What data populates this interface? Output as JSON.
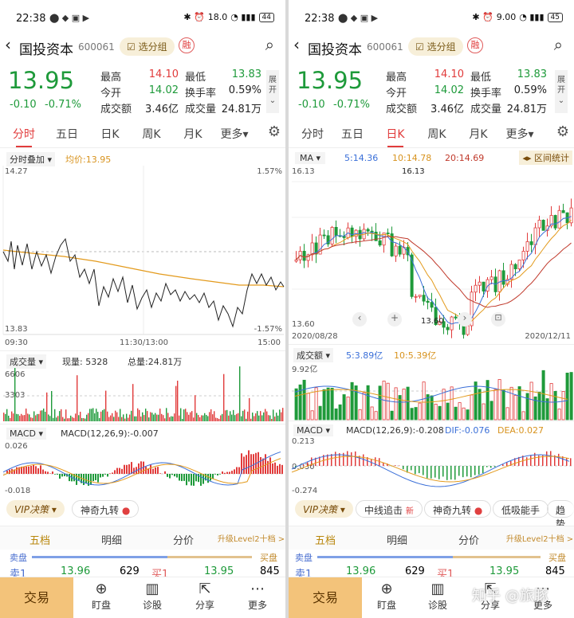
{
  "status_left": {
    "time": "22:38",
    "speed": "18.0",
    "speed_unit": "KB/S",
    "battery": "44"
  },
  "status_right": {
    "time": "22:38",
    "speed": "9.00",
    "speed_unit": "KB/S",
    "battery": "45"
  },
  "stock": {
    "name": "国投资本",
    "code": "600061",
    "add_group": "选分组",
    "rong": "融"
  },
  "quote": {
    "price": "13.95",
    "change": "-0.10",
    "change_pct": "-0.71%",
    "high_label": "最高",
    "high": "14.10",
    "low_label": "最低",
    "low": "13.83",
    "open_label": "今开",
    "open": "14.02",
    "turnover_label": "换手率",
    "turnover": "0.59%",
    "amount_label": "成交额",
    "amount": "3.46亿",
    "volume_label": "成交量",
    "volume": "24.81万",
    "expand": "展开"
  },
  "tabs": [
    "分时",
    "五日",
    "日K",
    "周K",
    "月K",
    "更多"
  ],
  "left": {
    "overlay_label": "分时叠加",
    "avg_label": "均价:13.95",
    "y_top": "14.27",
    "y_bottom": "13.83",
    "pct_top": "1.57%",
    "pct_bottom": "-1.57%",
    "t_start": "09:30",
    "t_mid": "11:30/13:00",
    "t_end": "15:00",
    "vol_label": "成交量",
    "vol_now": "现量: 5328",
    "vol_total": "总量:24.81万",
    "vol_y1": "6606",
    "vol_y2": "3303",
    "macd_label": "MACD",
    "macd_params": "MACD(12,26,9):-0.007",
    "macd_y1": "0.026",
    "macd_y2": "-0.018"
  },
  "right": {
    "ma_label": "MA",
    "ma5": "5:14.36",
    "ma10": "10:14.78",
    "ma20": "20:14.69",
    "range_stat": "区间统计",
    "y_top": "16.13",
    "y_bottom": "13.60",
    "hi_mark": "16.13",
    "lo_mark": "13.60",
    "d_start": "2020/08/28",
    "d_end": "2020/12/11",
    "vol_label": "成交额",
    "vol5": "5:3.89亿",
    "vol10": "10:5.39亿",
    "vol_y": "9.92亿",
    "macd_label": "MACD",
    "macd_params": "MACD(12,26,9):-0.208",
    "dif": "DIF:-0.076",
    "dea": "DEA:0.027",
    "macd_y1": "0.213",
    "macd_y2": "0.030",
    "macd_y3": "-0.274"
  },
  "tools_left": {
    "vip": "VIP决策",
    "nine": "神奇九转"
  },
  "tools_right": {
    "vip": "VIP决策",
    "mid": "中线追击",
    "new": "新",
    "nine": "神奇九转",
    "low": "低吸能手",
    "trend": "趋势"
  },
  "depth": {
    "t1": "五档",
    "t2": "明细",
    "t3": "分价",
    "level2": "升级Level2十档 >",
    "sell_side": "卖盘",
    "buy_side": "买盘",
    "sell1_label": "卖1",
    "sell1_price": "13.96",
    "sell1_vol": "629",
    "buy1_label": "买1",
    "buy1_price": "13.95",
    "buy1_vol": "845"
  },
  "bottom": {
    "trade": "交易",
    "watch": "盯盘",
    "diag": "诊股",
    "share": "分享",
    "more": "更多"
  },
  "watermark": "知乎 @旅豚",
  "colors": {
    "up": "#e13b3b",
    "down": "#1e9a3a",
    "accent": "#b8860b"
  }
}
